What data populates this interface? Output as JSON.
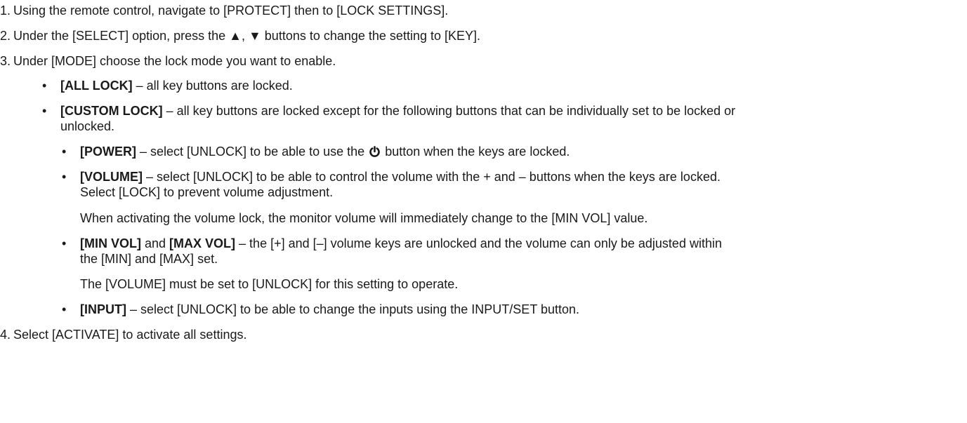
{
  "steps": [
    {
      "num": "1.",
      "text": "Using the remote control, navigate to [PROTECT] then to [LOCK SETTINGS]."
    },
    {
      "num": "2.",
      "text": "Under the [SELECT] option, press the ▲, ▼ buttons to change the setting to [KEY]."
    },
    {
      "num": "3.",
      "text": "Under [MODE] choose the lock mode you want to enable."
    },
    {
      "num": "4.",
      "text": "Select [ACTIVATE] to activate all settings."
    }
  ],
  "modes": {
    "all_lock": {
      "label": "[ALL LOCK]",
      "text": " – all key buttons are locked."
    },
    "custom_lock": {
      "label": "[CUSTOM LOCK]",
      "text_line1": " – all key buttons are locked except for the following buttons that can be individually set to be locked or",
      "text_line2": "unlocked."
    }
  },
  "custom_items": {
    "power": {
      "label": "[POWER]",
      "text_before": " – select [UNLOCK] to be able to use the ",
      "icon": "power-icon",
      "text_after": " button when the keys are locked."
    },
    "volume": {
      "label": "[VOLUME]",
      "text_line1": " – select [UNLOCK] to be able to control the volume with the + and – buttons when the keys are locked.",
      "text_line2": "Select [LOCK] to prevent volume adjustment.",
      "note": "When activating the volume lock, the monitor volume will immediately change to the [MIN VOL] value."
    },
    "minmax": {
      "label_min": "[MIN VOL]",
      "and": " and ",
      "label_max": "[MAX VOL]",
      "text_line1": " – the [+] and [–] volume keys are unlocked and the volume can only be adjusted within",
      "text_line2": "the [MIN] and [MAX] set.",
      "note": "The [VOLUME] must be set to [UNLOCK] for this setting to operate."
    },
    "input": {
      "label": "[INPUT]",
      "text": " – select [UNLOCK] to be able to change the inputs using the INPUT/SET button."
    }
  },
  "bullet_char": "•"
}
